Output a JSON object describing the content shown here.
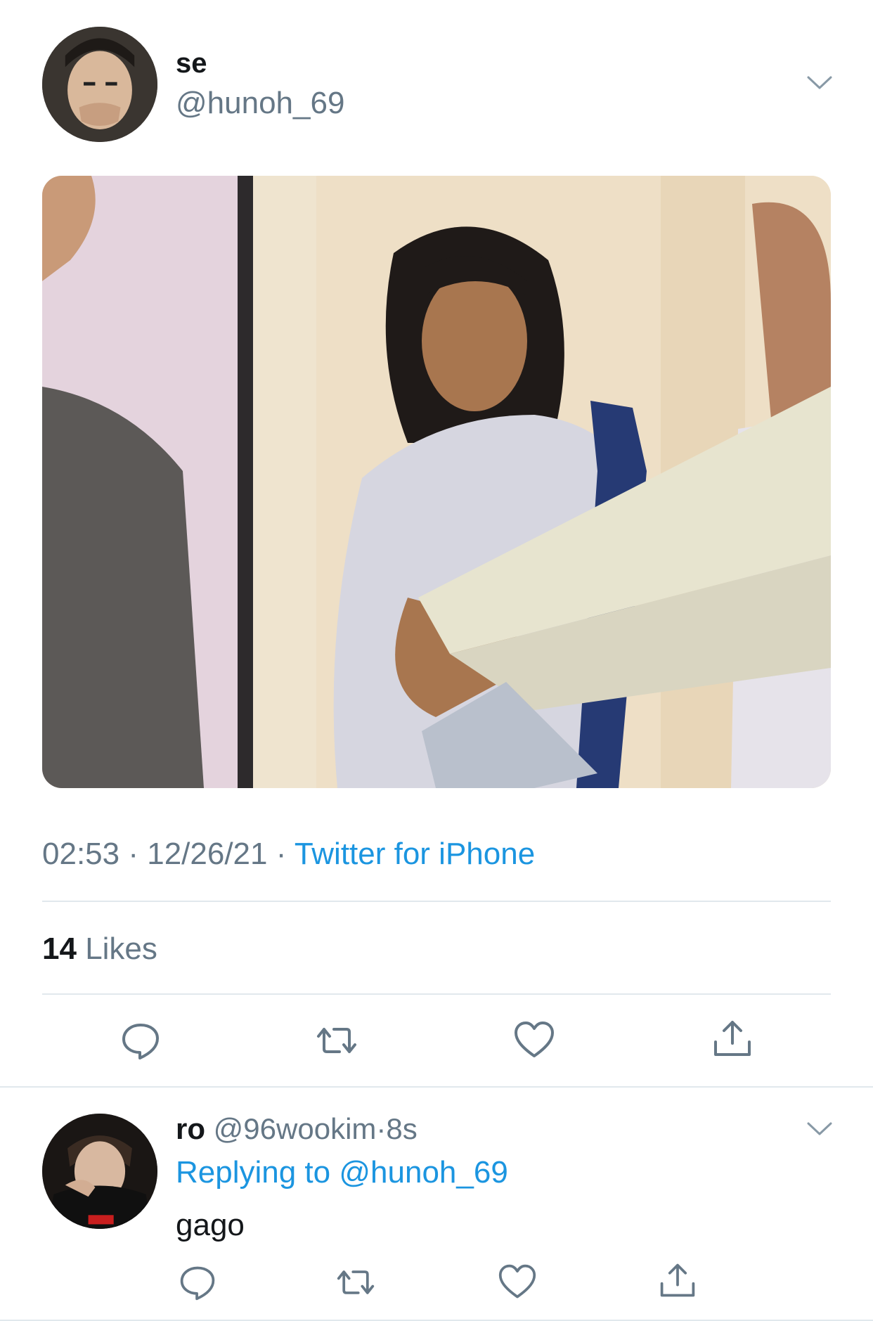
{
  "tweet": {
    "author_name": "se",
    "author_handle": "@hunoh_69",
    "time": "02:53",
    "date": "12/26/21",
    "source": "Twitter for iPhone",
    "likes_count": "14",
    "likes_label": "Likes",
    "separator": " · "
  },
  "reply": {
    "author_name": "ro",
    "author_handle": "@96wookim",
    "dot": "·",
    "age": "8s",
    "replying_label": "Replying to",
    "replying_handle": "@hunoh_69",
    "text": "gago"
  },
  "icons": {
    "reply": "reply-icon",
    "retweet": "retweet-icon",
    "like": "heart-icon",
    "share": "share-icon",
    "more": "chevron-down-icon"
  },
  "colors": {
    "link": "#1b95e0",
    "secondary": "#657786",
    "primary": "#14171a",
    "divider": "#e1e8ed"
  }
}
